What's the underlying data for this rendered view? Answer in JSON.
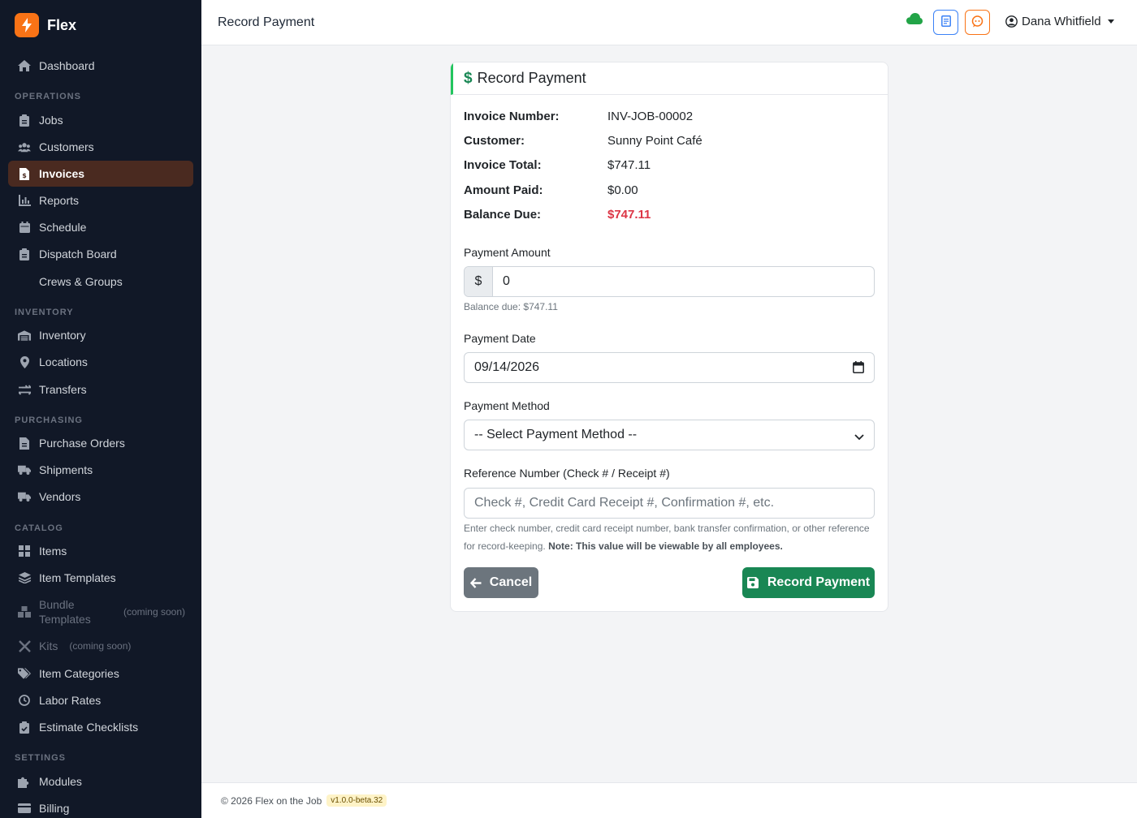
{
  "app": {
    "name": "Flex"
  },
  "sidebar": {
    "items": [
      {
        "label": "Dashboard"
      },
      {
        "label": "Jobs"
      },
      {
        "label": "Customers"
      },
      {
        "label": "Invoices"
      },
      {
        "label": "Reports"
      },
      {
        "label": "Schedule"
      },
      {
        "label": "Dispatch Board"
      },
      {
        "label": "Crews & Groups"
      },
      {
        "label": "Inventory"
      },
      {
        "label": "Locations"
      },
      {
        "label": "Transfers"
      },
      {
        "label": "Purchase Orders"
      },
      {
        "label": "Shipments"
      },
      {
        "label": "Vendors"
      },
      {
        "label": "Items"
      },
      {
        "label": "Item Templates"
      },
      {
        "label": "Bundle Templates",
        "note": "(coming soon)"
      },
      {
        "label": "Kits",
        "note": "(coming soon)"
      },
      {
        "label": "Item Categories"
      },
      {
        "label": "Labor Rates"
      },
      {
        "label": "Estimate Checklists"
      },
      {
        "label": "Modules"
      },
      {
        "label": "Billing"
      }
    ],
    "sections": [
      "OPERATIONS",
      "INVENTORY",
      "PURCHASING",
      "CATALOG",
      "SETTINGS"
    ]
  },
  "header": {
    "title": "Record Payment",
    "user": "Dana Whitfield"
  },
  "card": {
    "title": "Record Payment",
    "info": [
      {
        "label": "Invoice Number:",
        "value": "INV-JOB-00002"
      },
      {
        "label": "Customer:",
        "value": "Sunny Point Café"
      },
      {
        "label": "Invoice Total:",
        "value": "$747.11"
      },
      {
        "label": "Amount Paid:",
        "value": "$0.00"
      },
      {
        "label": "Balance Due:",
        "value": "$747.11"
      }
    ],
    "payment_amount": {
      "label": "Payment Amount",
      "prefix": "$",
      "value": "0",
      "help": "Balance due: $747.11"
    },
    "payment_date": {
      "label": "Payment Date",
      "value": "09/14/2026"
    },
    "payment_method": {
      "label": "Payment Method",
      "value": "-- Select Payment Method --"
    },
    "reference": {
      "label": "Reference Number (Check # / Receipt #)",
      "placeholder": "Check #, Credit Card Receipt #, Confirmation #, etc.",
      "help": "Enter check number, credit card receipt number, bank transfer confirmation, or other reference for record-keeping.",
      "help_note": "Note: This value will be viewable by all employees."
    },
    "cancel_label": "Cancel",
    "submit_label": "Record Payment"
  },
  "footer": {
    "copyright": "© 2026 Flex on the Job",
    "version": "v1.0.0-beta.32"
  },
  "colors": {
    "sidebar_bg": "#111827",
    "accent_orange": "#f97316",
    "active_item": "#4a2a20",
    "success": "#198754",
    "danger": "#dc3545"
  },
  "icons": [
    "bolt-icon",
    "home-icon",
    "clipboard-icon",
    "users-icon",
    "invoice-icon",
    "chart-icon",
    "calendar-icon",
    "board-icon",
    "warehouse-icon",
    "map-pin-icon",
    "transfer-icon",
    "truck-icon",
    "grid-icon",
    "layers-icon",
    "cubes-icon",
    "tools-icon",
    "tags-icon",
    "check-clipboard-icon",
    "puzzle-icon",
    "credit-card-icon",
    "cloud-icon",
    "notes-icon",
    "chat-icon",
    "user-circle-icon",
    "dollar-icon",
    "arrow-left-icon",
    "save-icon"
  ]
}
